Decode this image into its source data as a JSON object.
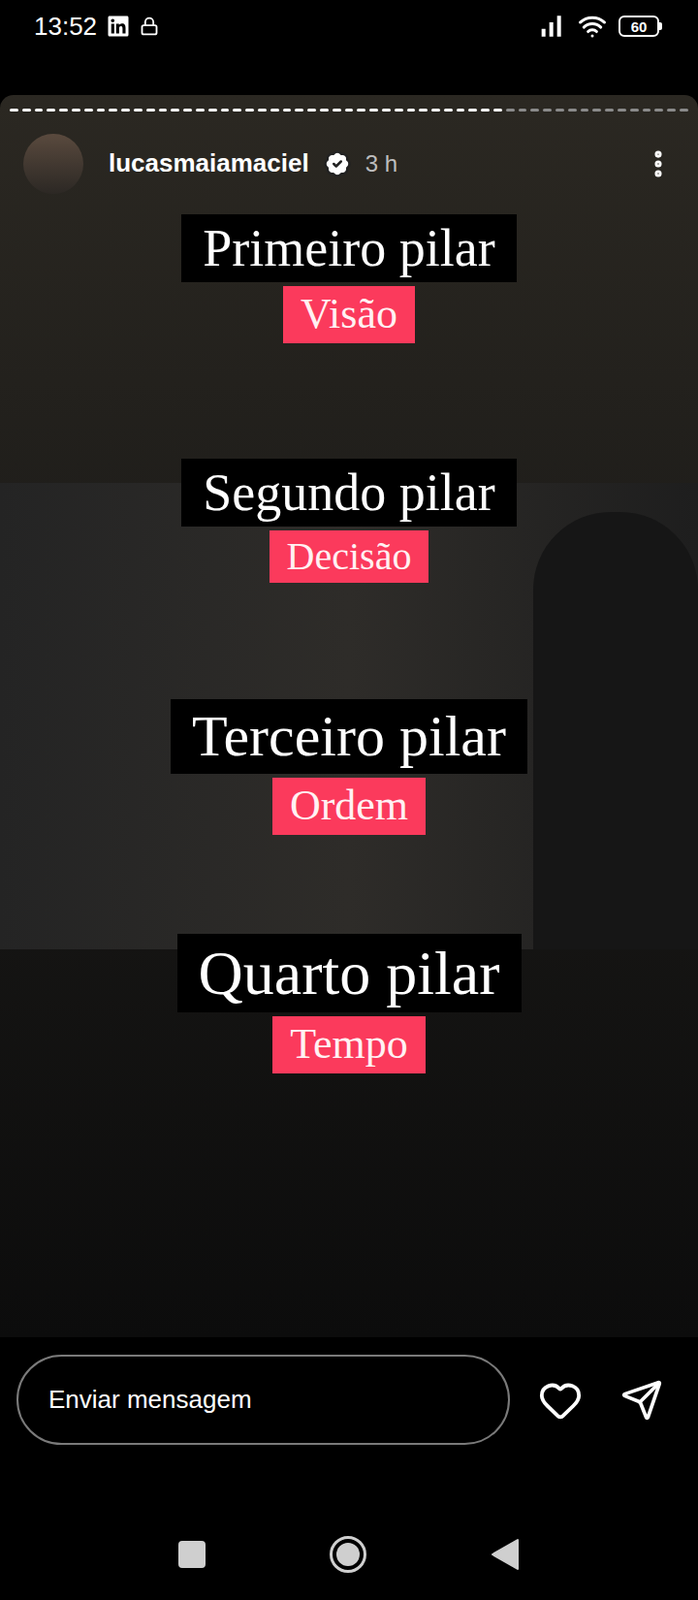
{
  "status_bar": {
    "time": "13:52",
    "battery": "60"
  },
  "story": {
    "progress": {
      "segments": 55,
      "viewed": 40
    },
    "author": {
      "username": "lucasmaiamaciel",
      "verified": true,
      "time": "3 h"
    },
    "pillars": [
      {
        "title": "Primeiro pilar",
        "name": "Visão"
      },
      {
        "title": "Segundo pilar",
        "name": "Decisão"
      },
      {
        "title": "Terceiro pilar",
        "name": "Ordem"
      },
      {
        "title": "Quarto pilar",
        "name": "Tempo"
      }
    ]
  },
  "reply_bar": {
    "placeholder": "Enviar mensagem"
  }
}
